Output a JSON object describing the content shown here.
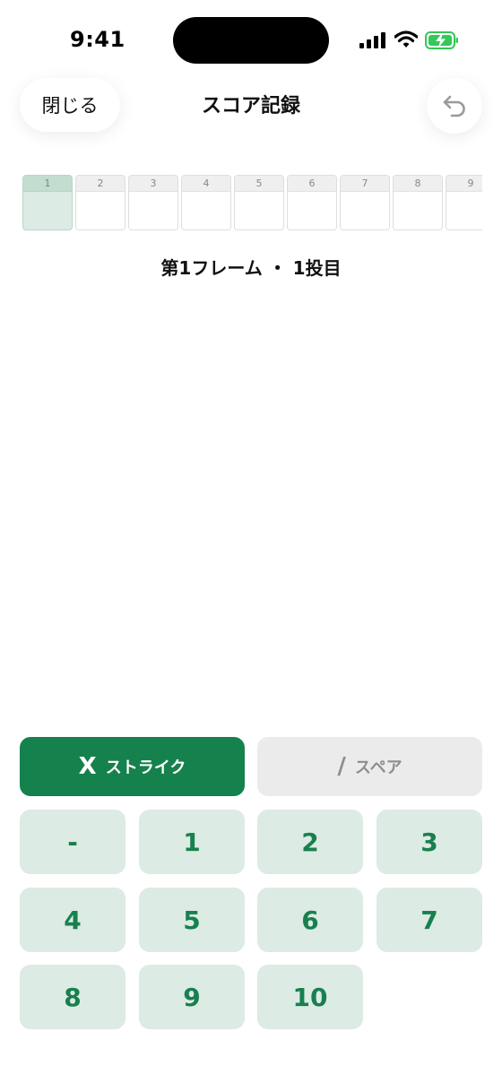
{
  "status_bar": {
    "time": "9:41"
  },
  "nav": {
    "close_label": "閉じる",
    "title": "スコア記録"
  },
  "frames": [
    "1",
    "2",
    "3",
    "4",
    "5",
    "6",
    "7",
    "8",
    "9"
  ],
  "current_status": "第1フレーム ・ 1投目",
  "keypad": {
    "strike": {
      "symbol": "X",
      "label": "ストライク"
    },
    "spare": {
      "symbol": "/",
      "label": "スペア"
    },
    "keys": [
      "-",
      "1",
      "2",
      "3",
      "4",
      "5",
      "6",
      "7",
      "8",
      "9",
      "10"
    ]
  },
  "colors": {
    "accent": "#15814d",
    "key_bg": "#dcebe3",
    "key_text": "#18804f",
    "disabled_bg": "#ebebeb",
    "disabled_text": "#8e8e8e"
  }
}
